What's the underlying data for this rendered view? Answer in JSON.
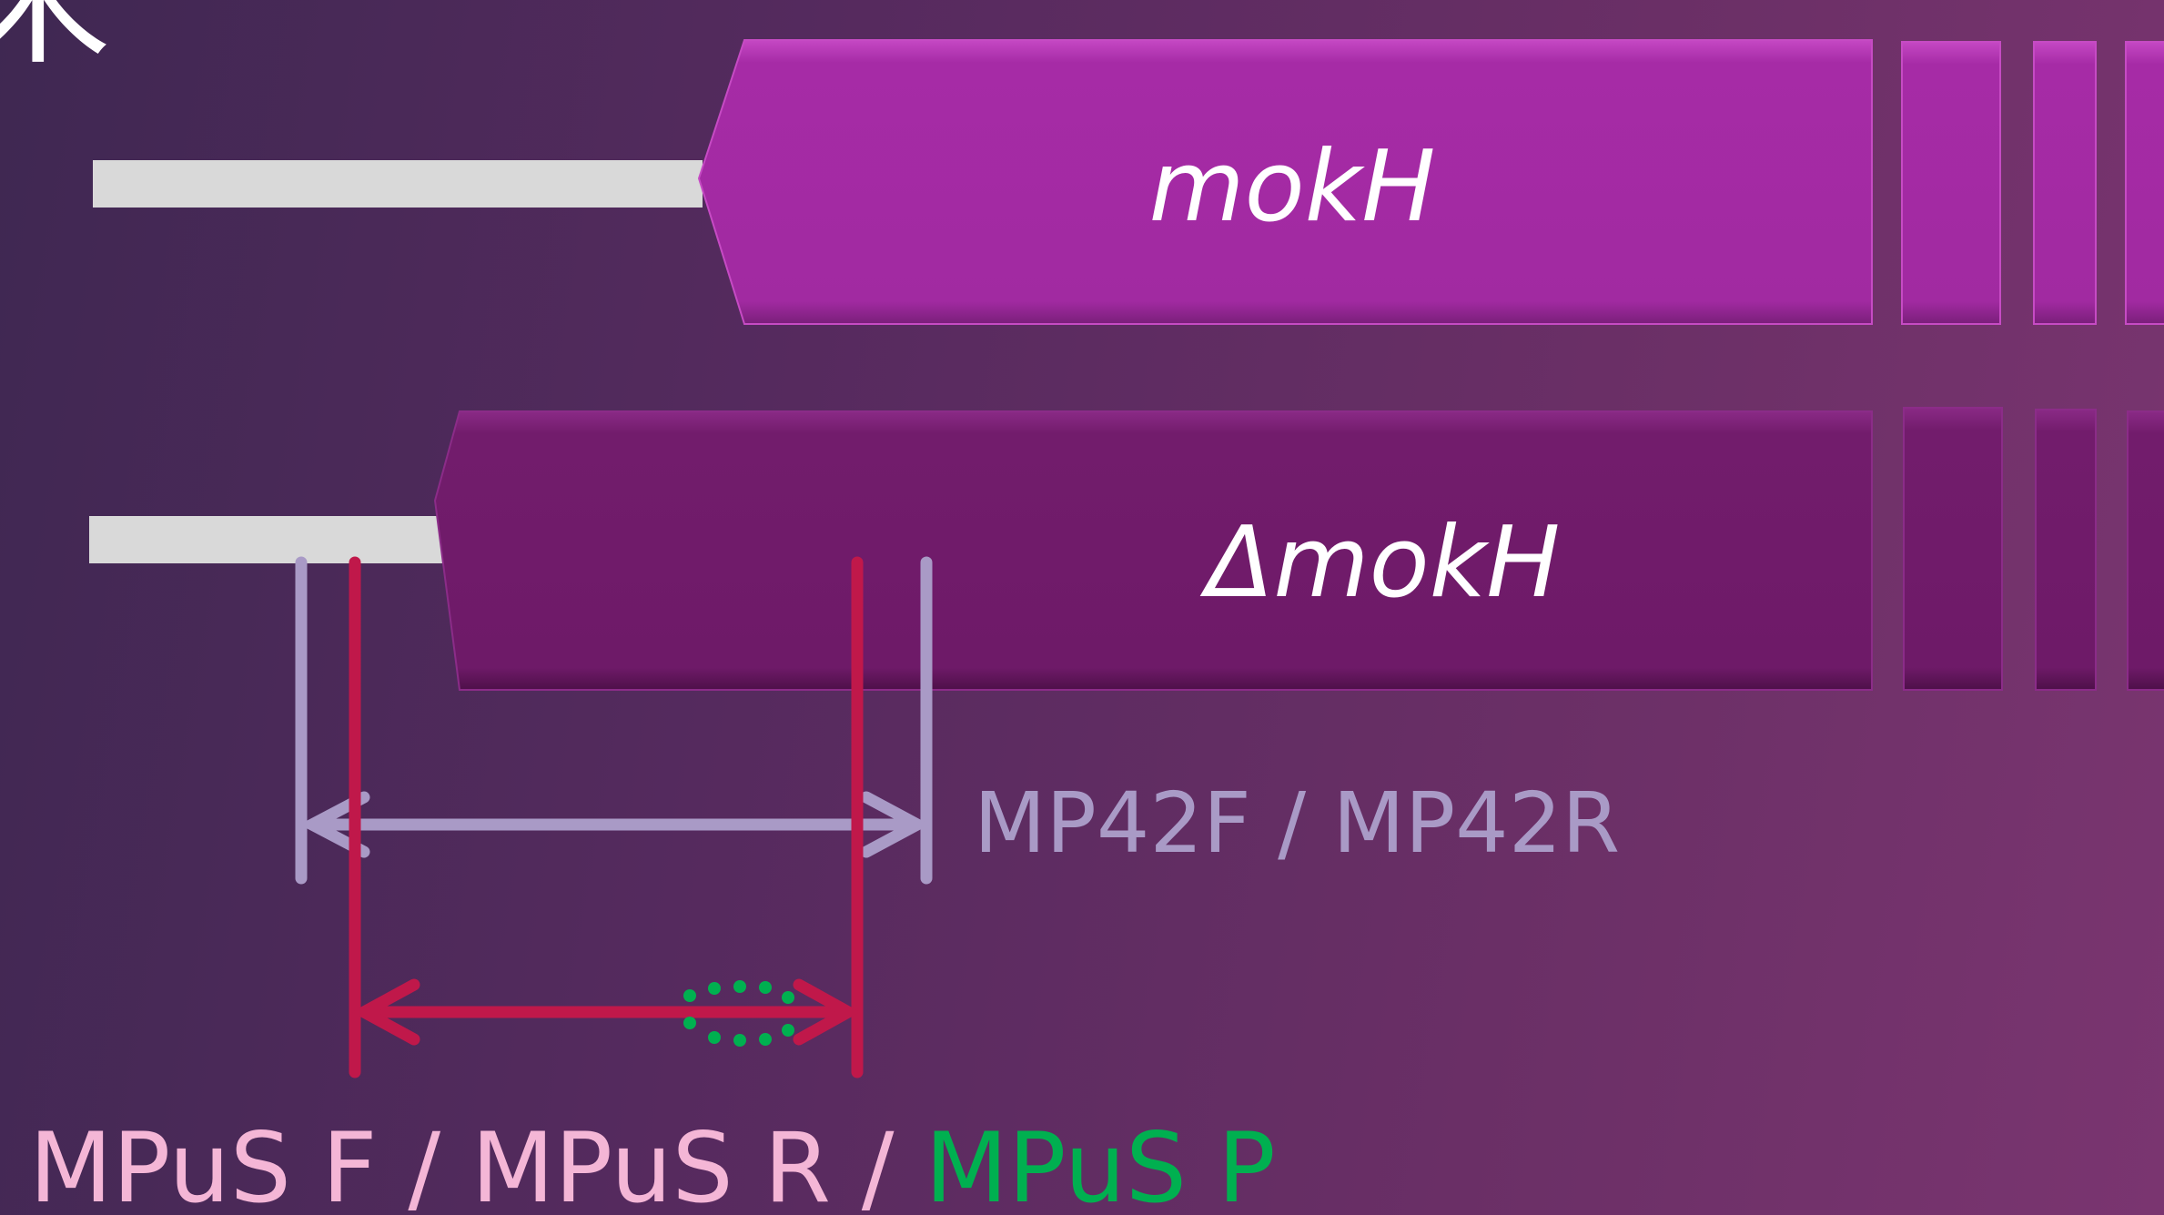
{
  "corner_glyph": "米",
  "genes": {
    "wildtype": {
      "label": "mokH"
    },
    "mutant": {
      "label": "ΔmokH"
    }
  },
  "primers": {
    "outer_label": "MP42F / MP42R",
    "inner_label_part1": "MPuS F / MPuS R / ",
    "inner_label_part2": "MPuS P"
  },
  "colors": {
    "background": "#552a5e",
    "wildtype_exon": "#a62ba6",
    "mutant_exon": "#721c6c",
    "flank_bar": "#d9d9d9",
    "outer_primer": "#a99ac6",
    "inner_primer": "#c0184a",
    "probe": "#00b050",
    "inner_label_text": "#f4b6d6"
  }
}
